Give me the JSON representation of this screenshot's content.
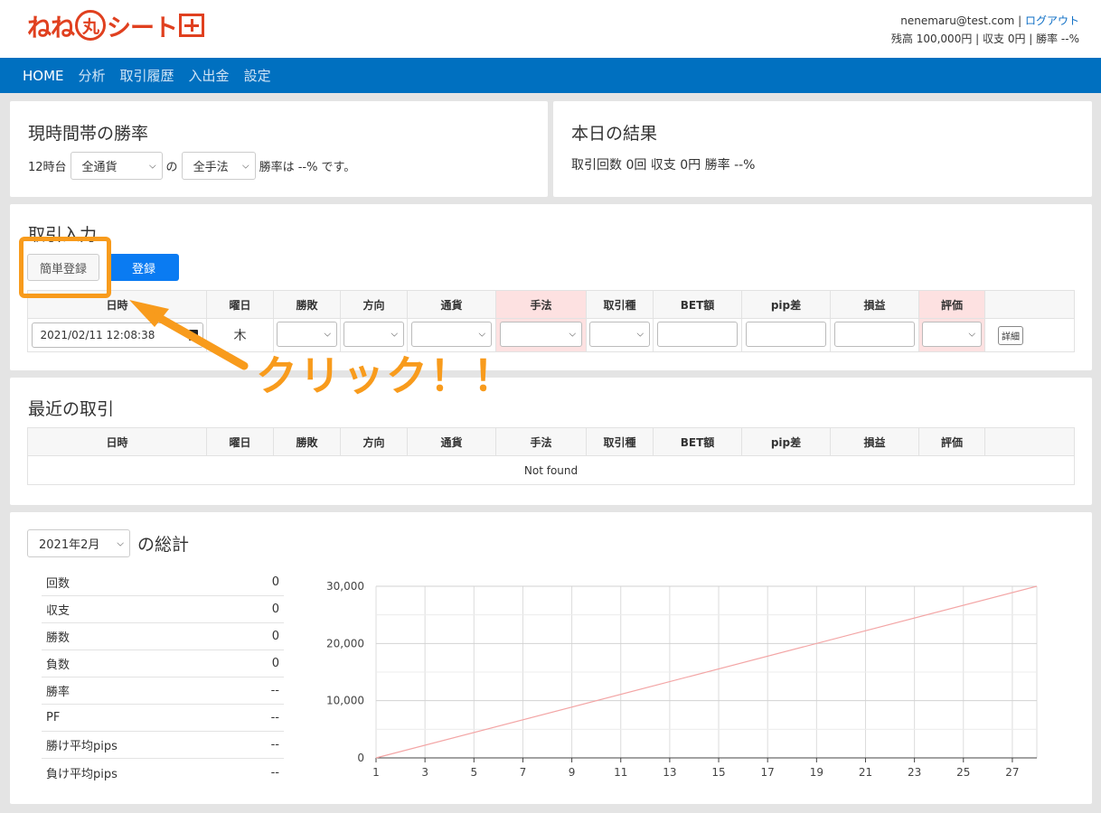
{
  "header": {
    "logo_text_1": "ねね",
    "logo_circle": "丸",
    "logo_text_2": "シート",
    "user_email": "nenemaru@test.com",
    "logout_label": "ログアウト",
    "summary_line": "残高 100,000円 | 収支 0円 | 勝率 --%"
  },
  "nav": {
    "items": [
      {
        "label": "HOME",
        "active": true
      },
      {
        "label": "分析"
      },
      {
        "label": "取引履歴"
      },
      {
        "label": "入出金"
      },
      {
        "label": "設定"
      }
    ]
  },
  "winrate_card": {
    "title": "現時間帯の勝率",
    "hour_label": "12時台",
    "currency_select": "全通貨",
    "of_label": "の",
    "method_select": "全手法",
    "result_text": "勝率は --% です。"
  },
  "today_card": {
    "title": "本日の結果",
    "result_text": "取引回数 0回 収支 0円 勝率 --%"
  },
  "entry_card": {
    "title": "取引入力",
    "quick_button": "簡単登録",
    "register_button": "登録",
    "columns": [
      "日時",
      "曜日",
      "勝敗",
      "方向",
      "通貨",
      "手法",
      "取引種",
      "BET額",
      "pip差",
      "損益",
      "評価",
      ""
    ],
    "datetime_value": "2021/02/11 12:08:38",
    "weekday_value": "木",
    "detail_button": "詳細"
  },
  "annotation": {
    "text": "クリック！！",
    "color": "#f89b1c"
  },
  "recent_card": {
    "title": "最近の取引",
    "columns": [
      "日時",
      "曜日",
      "勝敗",
      "方向",
      "通貨",
      "手法",
      "取引種",
      "BET額",
      "pip差",
      "損益",
      "評価",
      ""
    ],
    "empty_text": "Not found"
  },
  "summary_card": {
    "month_select": "2021年2月",
    "title_suffix": "の総計",
    "stats": [
      {
        "label": "回数",
        "value": "0"
      },
      {
        "label": "収支",
        "value": "0"
      },
      {
        "label": "勝数",
        "value": "0"
      },
      {
        "label": "負数",
        "value": "0"
      },
      {
        "label": "勝率",
        "value": "--"
      },
      {
        "label": "PF",
        "value": "--"
      },
      {
        "label": "勝け平均pips",
        "value": "--"
      },
      {
        "label": "負け平均pips",
        "value": "--"
      }
    ]
  },
  "chart_data": {
    "type": "line",
    "x": [
      1,
      28
    ],
    "series": [
      {
        "values": [
          0,
          30000
        ]
      }
    ],
    "xticks": [
      "1",
      "3",
      "5",
      "7",
      "9",
      "11",
      "13",
      "15",
      "17",
      "19",
      "21",
      "23",
      "25",
      "27"
    ],
    "yticks": [
      "0",
      "10,000",
      "20,000",
      "30,000"
    ],
    "xlim": [
      1,
      28
    ],
    "ylim": [
      0,
      30000
    ],
    "grid": true,
    "line_color": "#f3a5a5"
  },
  "colors": {
    "accent_blue": "#0070c0",
    "primary_button": "#0a7bf2",
    "brand_red": "#e0401f",
    "highlight_pink": "#fde1e1"
  }
}
